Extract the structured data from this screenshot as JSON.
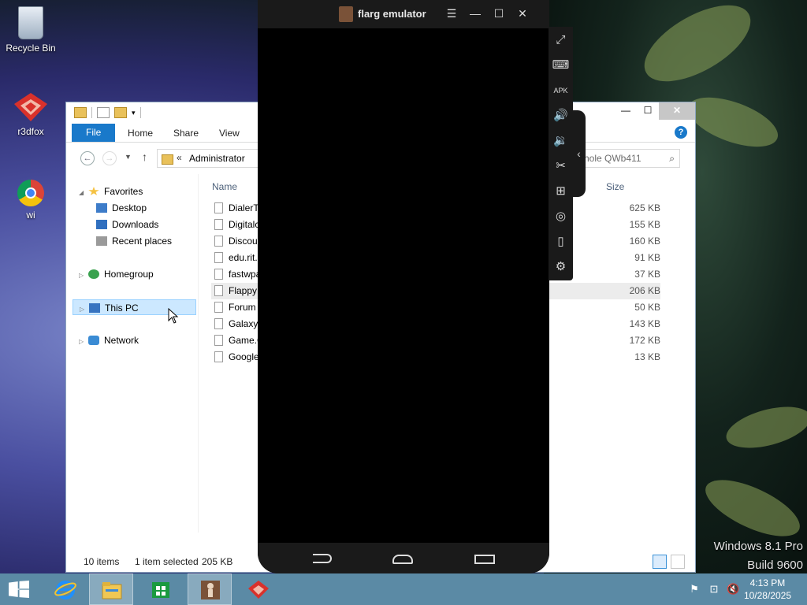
{
  "desktop": {
    "icons": [
      {
        "label": "Recycle Bin"
      },
      {
        "label": "r3dfox"
      },
      {
        "label": "wi"
      }
    ],
    "watermark": {
      "line1": "Windows 8.1 Pro",
      "line2": "Build 9600"
    }
  },
  "explorer": {
    "ribbon_tabs": {
      "file": "File",
      "home": "Home",
      "share": "Share",
      "view": "View"
    },
    "address": {
      "chevron": "«",
      "path": "Administrator"
    },
    "search": {
      "placeholder": "hole QWb411"
    },
    "help": "?",
    "nav": {
      "favorites": "Favorites",
      "desktop": "Desktop",
      "downloads": "Downloads",
      "recent_places": "Recent places",
      "homegroup": "Homegroup",
      "this_pc": "This PC",
      "network": "Network"
    },
    "columns": {
      "name": "Name",
      "size": "Size"
    },
    "files": [
      {
        "name": "DialerT",
        "size": "625 KB"
      },
      {
        "name": "Digitalc",
        "size": "155 KB"
      },
      {
        "name": "Discou",
        "size": "160 KB"
      },
      {
        "name": "edu.rit.",
        "size": "91 KB"
      },
      {
        "name": "fastwpa",
        "size": "37 KB"
      },
      {
        "name": "Flappy",
        "size": "206 KB"
      },
      {
        "name": "Forum",
        "size": "50 KB"
      },
      {
        "name": "Galaxy-",
        "size": "143 KB"
      },
      {
        "name": "Game.C",
        "size": "172 KB"
      },
      {
        "name": "Google",
        "size": "13 KB"
      }
    ],
    "status": {
      "items": "10 items",
      "selected": "1 item selected",
      "selected_size": "205 KB"
    }
  },
  "emulator": {
    "title": "flarg emulator",
    "side_icons": [
      "fullscreen-icon",
      "keyboard-icon",
      "apk-icon",
      "volume-up-icon",
      "volume-down-icon",
      "scissors-icon",
      "add-window-icon",
      "location-icon",
      "shake-icon",
      "settings-icon"
    ]
  },
  "taskbar": {
    "clock": {
      "time": "4:13 PM",
      "date": "10/28/2025"
    }
  },
  "colors": {
    "ribbon_file": "#1979ca",
    "taskbar": "#5b8aa5",
    "selection": "#cce8ff"
  }
}
